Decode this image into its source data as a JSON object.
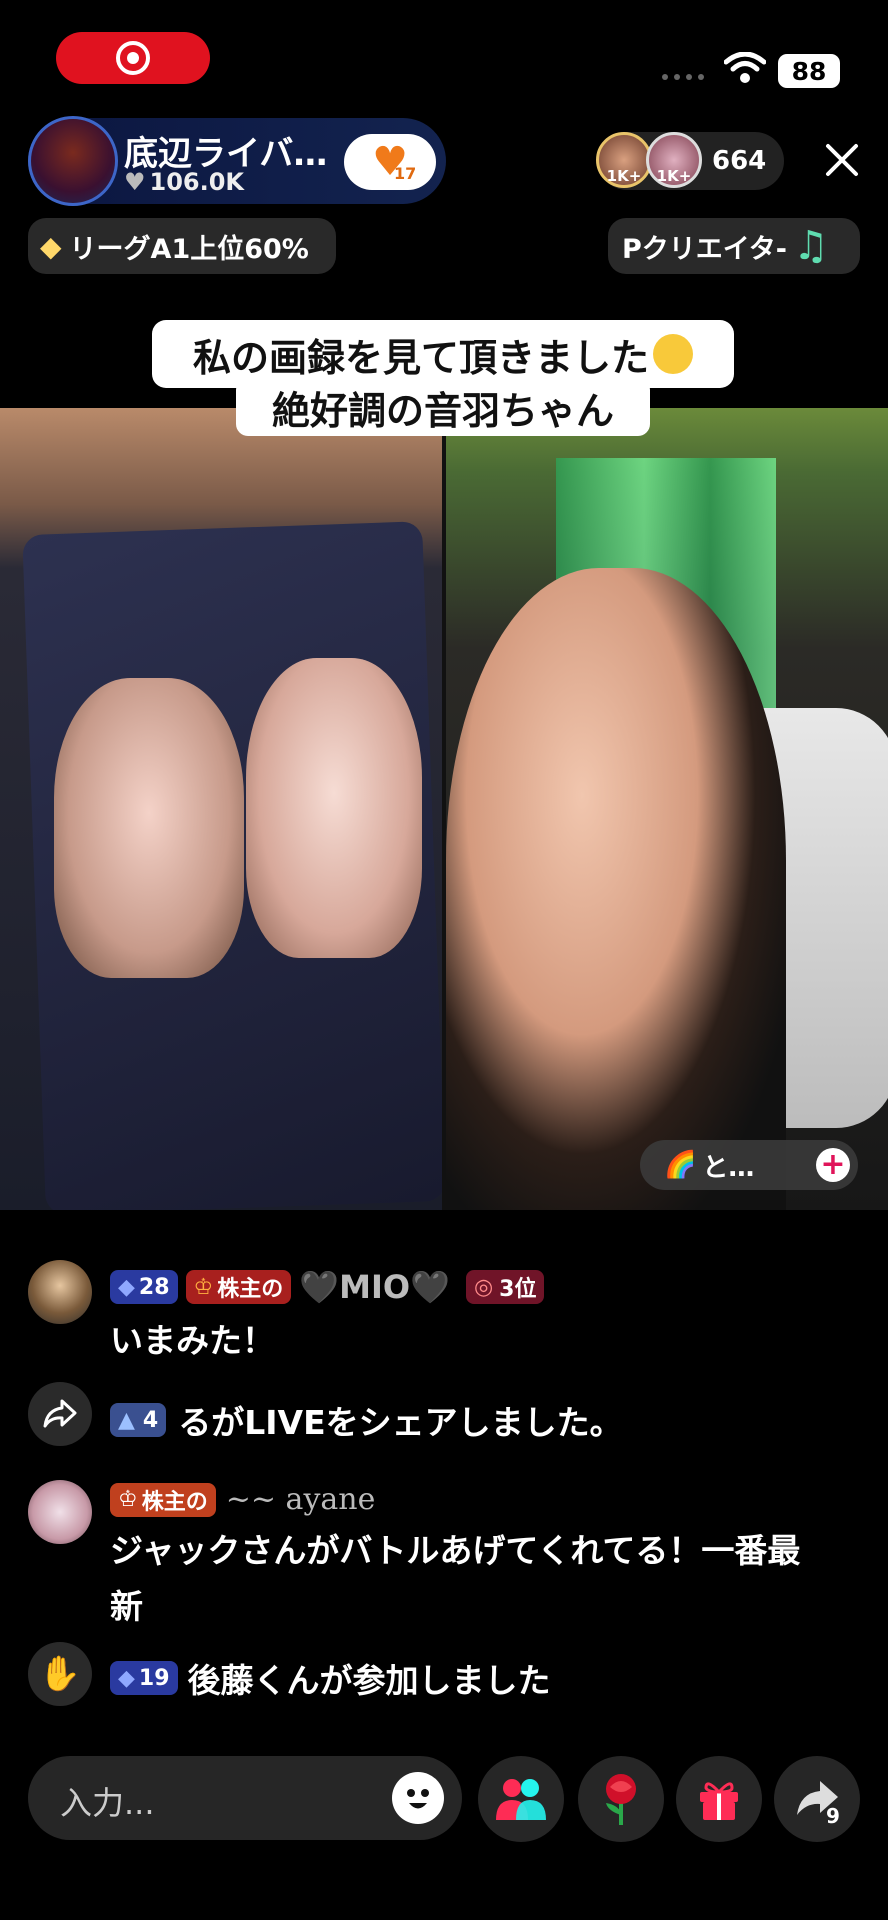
{
  "status_bar": {
    "battery": "88"
  },
  "host": {
    "name": "底辺ライバ…",
    "likes": "106.0K",
    "fan_level": "17"
  },
  "viewers": {
    "top1_badge": "1K+",
    "top2_badge": "1K+",
    "count": "664"
  },
  "chips": {
    "league": "リーグA1上位60%",
    "creator": "Pクリエイタ-"
  },
  "caption": {
    "line1": "私の画録を見て頂きました",
    "line2": "絶好調の音羽ちゃん"
  },
  "video": {
    "join_label": "と…"
  },
  "chat": [
    {
      "level": "28",
      "sub_badge": "株主の",
      "username": "🖤MIO🖤",
      "rank_badge": "3位",
      "text": "いまみた！"
    },
    {
      "level": "4",
      "text": "るがLIVEをシェアしました。"
    },
    {
      "sub_badge": "株主の",
      "username": "~~ ayane",
      "text_line1": "ジャックさんがバトルあげてくれてる！一番最",
      "text_line2": "新"
    },
    {
      "level": "19",
      "text": "後藤くんが参加しました"
    }
  ],
  "input": {
    "placeholder": "入力..."
  },
  "share": {
    "count": "9"
  },
  "colors": {
    "record": "#e0121f",
    "accent_pink": "#fe2c55",
    "accent_cyan": "#25f4ee",
    "badge_blue": "#2a3aa0",
    "badge_red": "#a8201e"
  }
}
